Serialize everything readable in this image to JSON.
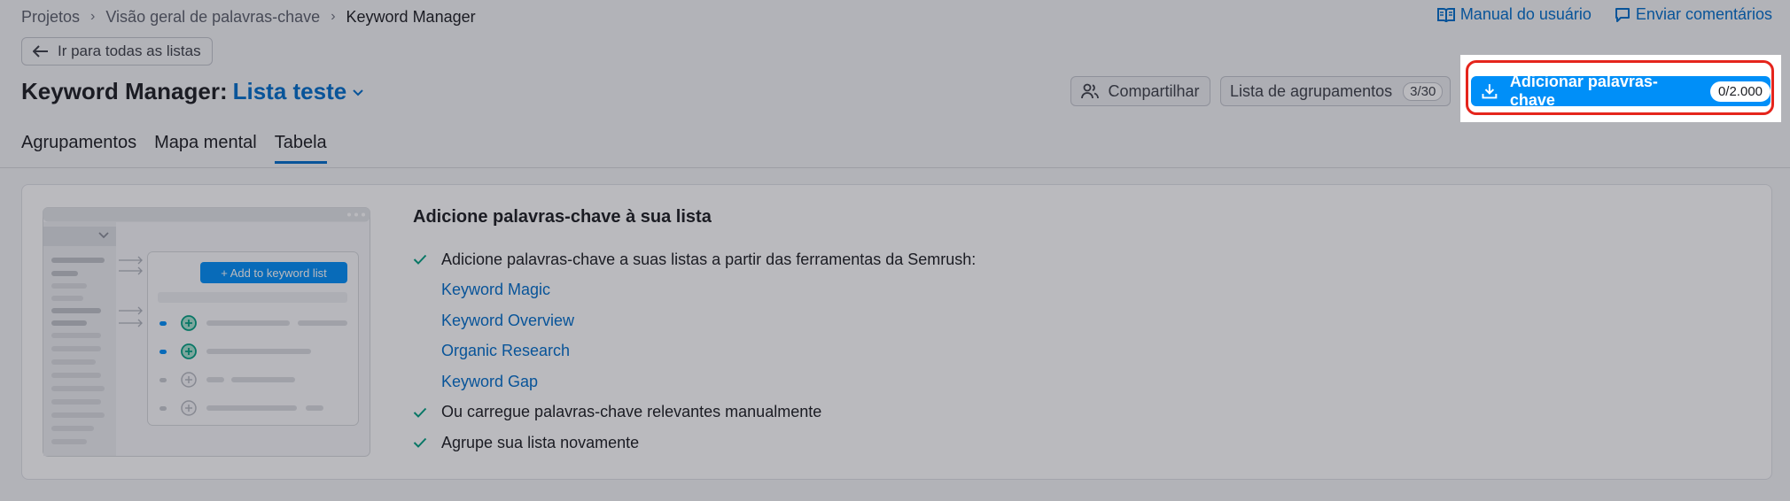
{
  "breadcrumb": {
    "items": [
      "Projetos",
      "Visão geral de palavras-chave",
      "Keyword Manager"
    ]
  },
  "top_links": {
    "manual": "Manual do usuário",
    "feedback": "Enviar comentários"
  },
  "back_button": "Ir para todas as listas",
  "header": {
    "title": "Keyword Manager:",
    "list_name": "Lista teste",
    "share": "Compartilhar",
    "groups_list": "Lista de agrupamentos",
    "groups_count": "3/30",
    "add_keywords": "Adicionar palavras-chave",
    "add_count": "0/2.000"
  },
  "tabs": [
    "Agrupamentos",
    "Mapa mental",
    "Tabela"
  ],
  "active_tab": "Tabela",
  "empty_state": {
    "title": "Adicione palavras-chave à sua lista",
    "step1": "Adicione palavras-chave a suas listas a partir das ferramentas da Semrush:",
    "tools": [
      "Keyword Magic",
      "Keyword Overview",
      "Organic Research",
      "Keyword Gap"
    ],
    "step2": "Ou carregue palavras-chave relevantes manualmente",
    "step3": "Agrupe sua lista novamente",
    "illustration_button": "+ Add to keyword list"
  },
  "colors": {
    "accent": "#006dca",
    "primary_button": "#008ff8",
    "highlight": "#e5251c",
    "check": "#009f81"
  }
}
